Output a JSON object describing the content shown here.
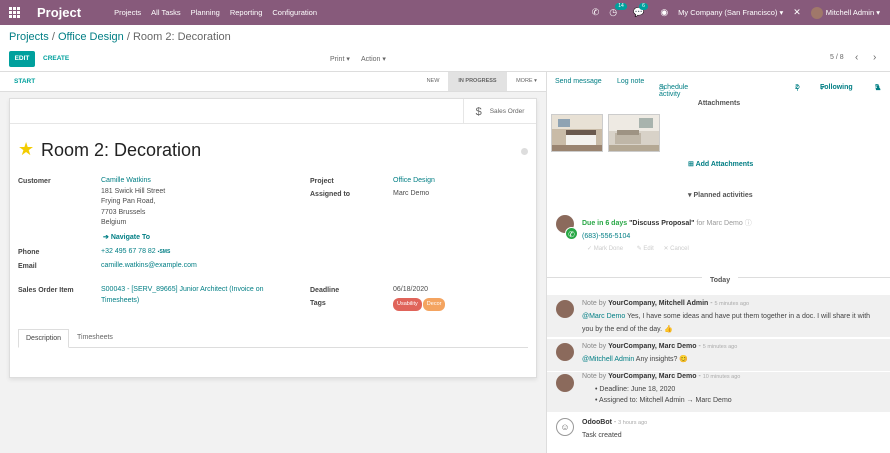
{
  "topbar": {
    "app_name": "Project",
    "menu": [
      "Projects",
      "All Tasks",
      "Planning",
      "Reporting",
      "Configuration"
    ],
    "activity_badge": "14",
    "message_badge": "6",
    "company": "My Company (San Francisco)",
    "user": "Mitchell Admin"
  },
  "breadcrumb": {
    "projects": "Projects",
    "project": "Office Design",
    "current": "Room 2: Decoration"
  },
  "toolbar": {
    "edit": "EDIT",
    "create": "CREATE",
    "print": "Print",
    "action": "Action",
    "pager": "5 / 8"
  },
  "statusbar": {
    "start": "START",
    "stages": [
      "NEW",
      "IN PROGRESS",
      "MORE"
    ],
    "active_stage": "IN PROGRESS"
  },
  "smart_button": {
    "label": "Sales Order"
  },
  "task": {
    "title": "Room 2: Decoration",
    "customer_label": "Customer",
    "customer_name": "Camille Watkins",
    "address": [
      "181 Swick Hill Street",
      "Frying Pan Road,",
      "7703 Brussels",
      "Belgium"
    ],
    "navigate": "Navigate To",
    "phone_label": "Phone",
    "phone": "+32 495 67 78 82",
    "sms": "SMS",
    "email_label": "Email",
    "email": "camille.watkins@example.com",
    "sol_label": "Sales Order Item",
    "sol_line1": "S00043 - [SERV_89665] Junior Architect (Invoice on",
    "sol_line2": "Timesheets)",
    "project_label": "Project",
    "project": "Office Design",
    "assigned_label": "Assigned to",
    "assigned": "Marc Demo",
    "deadline_label": "Deadline",
    "deadline": "06/18/2020",
    "tags_label": "Tags",
    "tags": [
      {
        "name": "Usability",
        "color": "#e0645a"
      },
      {
        "name": "Decor",
        "color": "#f4a460"
      }
    ]
  },
  "tabs": [
    "Description",
    "Timesheets"
  ],
  "chatter": {
    "send_message": "Send message",
    "log_note": "Log note",
    "schedule": "Schedule activity",
    "attachments_count": "2",
    "following": "Following",
    "followers_count": "5",
    "attachments_title": "Attachments",
    "add_attachments": "Add Attachments",
    "planned_title": "Planned activities",
    "activity": {
      "due": "Due in 6 days",
      "summary": "\"Discuss Proposal\"",
      "for_text": "for Marc Demo",
      "phone": "(683)-556-5104",
      "mark_done": "Mark Done",
      "edit": "Edit",
      "cancel": "Cancel"
    },
    "today": "Today",
    "messages": [
      {
        "prefix": "Note by",
        "author": "YourCompany, Mitchell Admin",
        "time": "5 minutes ago",
        "mention": "@Marc Demo",
        "text": "Yes, I have some ideas and have put them together in a doc. I will share it with",
        "text2": "you by the end of the day."
      },
      {
        "prefix": "Note by",
        "author": "YourCompany, Marc Demo",
        "time": "5 minutes ago",
        "mention": "@Mitchell Admin",
        "text": "Any insights?"
      },
      {
        "prefix": "Note by",
        "author": "YourCompany, Marc Demo",
        "time": "10 minutes ago",
        "bullet1": "Deadline: June 18, 2020",
        "bullet2": "Assigned to: Mitchell Admin → Marc Demo"
      },
      {
        "author": "OdooBot",
        "time": "3 hours ago",
        "text": "Task created"
      }
    ]
  },
  "colors": {
    "brand": "#875a7b",
    "accent": "#00a09d",
    "link": "#017e84"
  }
}
